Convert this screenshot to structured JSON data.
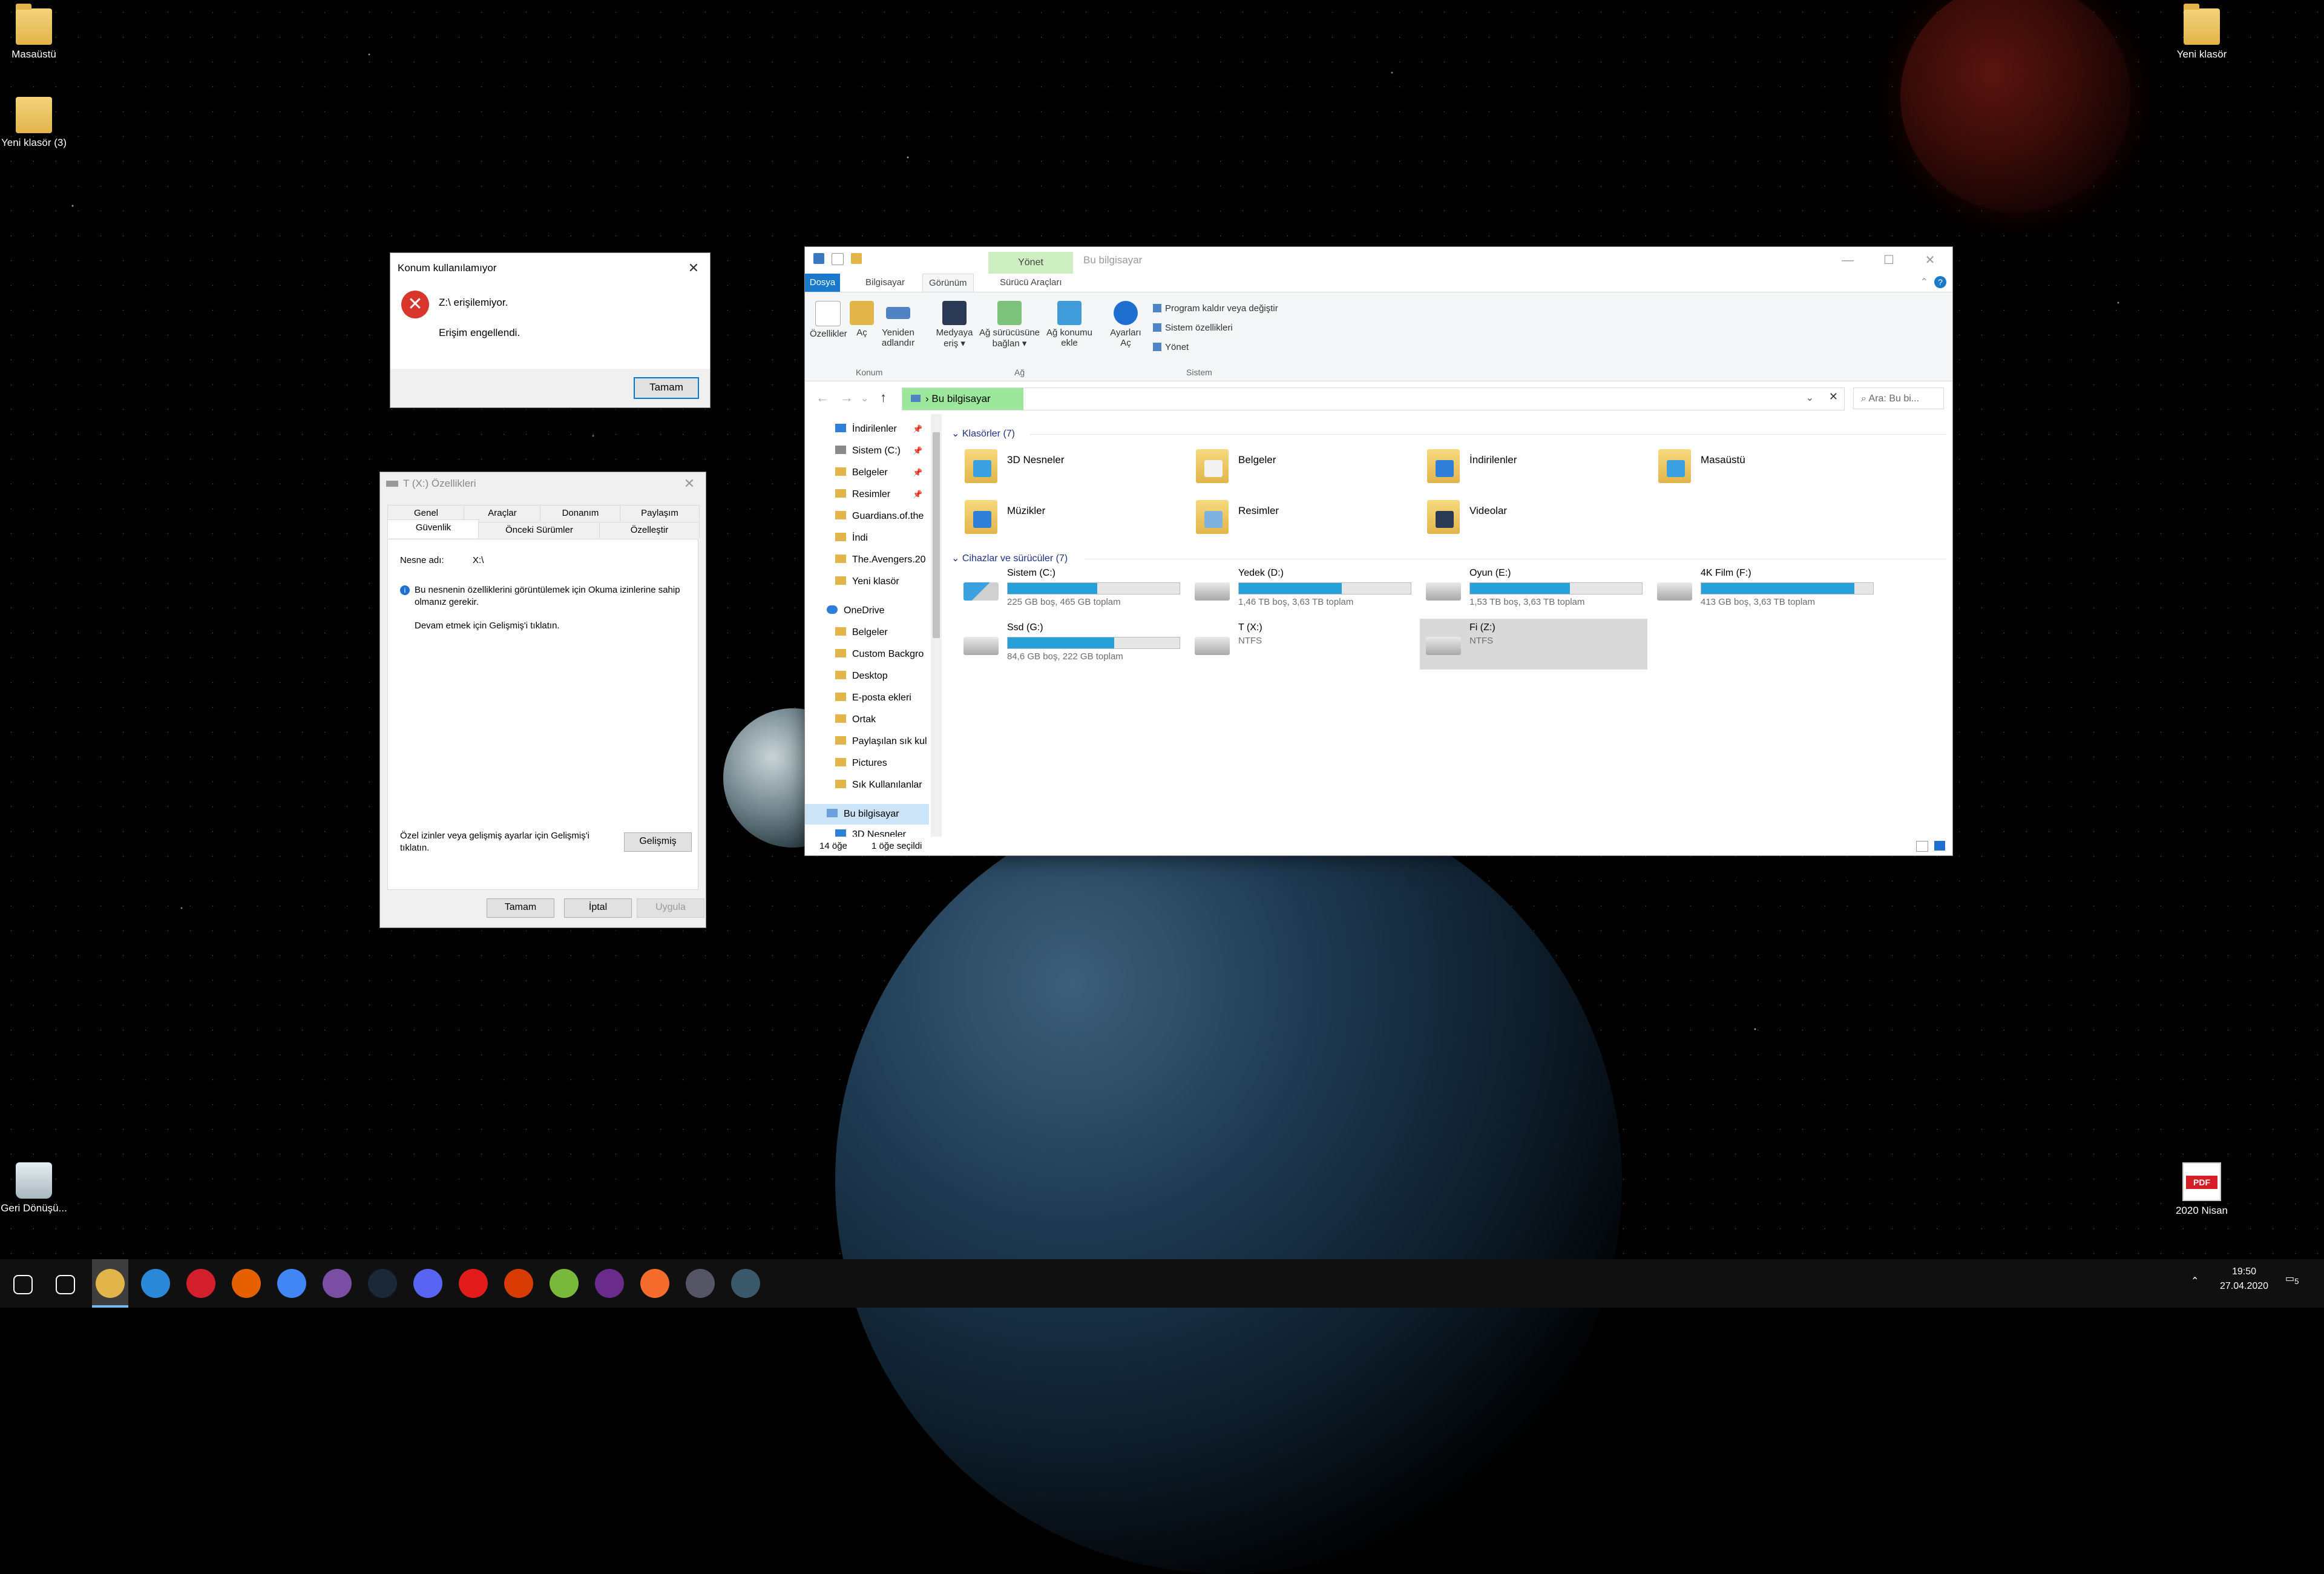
{
  "desktop": {
    "icons_left": [
      {
        "label": "Masaüstü",
        "icon": "folder-zip-icon"
      },
      {
        "label": "Yeni klasör (3)",
        "icon": "folder-doc-icon"
      },
      {
        "label": "Geri Dönüşü...",
        "icon": "recycle-bin-icon"
      }
    ],
    "icons_right": [
      {
        "label": "Yeni klasör",
        "icon": "folder-icon"
      },
      {
        "label": "2020 Nisan",
        "icon": "pdf-file-icon",
        "badge": "PDF"
      }
    ]
  },
  "error_dialog": {
    "title": "Konum kullanılamıyor",
    "message": "Z:\\ erişilemiyor.",
    "detail": "Erişim engellendi.",
    "ok_label": "Tamam"
  },
  "properties_dialog": {
    "title": "T (X:) Özellikleri",
    "tabs_row1": [
      "Genel",
      "Araçlar",
      "Donanım",
      "Paylaşım"
    ],
    "tabs_row2": [
      "Güvenlik",
      "Önceki Sürümler",
      "Özelleştir"
    ],
    "object_label": "Nesne adı:",
    "object_value": "X:\\",
    "info_text": "Bu nesnenin özelliklerini görüntülemek için Okuma izinlerine sahip olmanız gerekir.",
    "continue_text": "Devam etmek için Gelişmiş'i tıklatın.",
    "advanced_text": "Özel izinler veya gelişmiş ayarlar için Gelişmiş'i tıklatın.",
    "advanced_button": "Gelişmiş",
    "ok_button": "Tamam",
    "cancel_button": "İptal",
    "apply_button": "Uygula"
  },
  "explorer": {
    "title": "Bu bilgisayar",
    "contextual_tab": "Yönet",
    "ribbon_tabs": [
      "Dosya",
      "Bilgisayar",
      "Görünüm",
      "Sürücü Araçları"
    ],
    "ribbon_buttons": [
      {
        "label": "Özellikler",
        "icon": "properties-icon"
      },
      {
        "label": "Aç",
        "icon": "open-folder-icon"
      },
      {
        "label": "Yeniden adlandır",
        "icon": "rename-icon"
      },
      {
        "label": "Medyaya eriş ▾",
        "icon": "media-access-icon"
      },
      {
        "label": "Ağ sürücüsüne bağlan ▾",
        "icon": "map-network-drive-icon"
      },
      {
        "label": "Ağ konumu ekle",
        "icon": "add-network-location-icon"
      },
      {
        "label": "Ayarları Aç",
        "icon": "settings-icon"
      }
    ],
    "ribbon_small": [
      "Program kaldır veya değiştir",
      "Sistem özellikleri",
      "Yönet"
    ],
    "ribbon_groups": [
      "Konum",
      "Ağ",
      "Sistem"
    ],
    "address": "Bu bilgisayar",
    "search_placeholder": "Ara: Bu bi...",
    "nav_items": [
      {
        "label": "İndirilenler",
        "pinned": true,
        "icon": "blue"
      },
      {
        "label": "Sistem (C:)",
        "pinned": true,
        "icon": "drive"
      },
      {
        "label": "Belgeler",
        "pinned": true,
        "icon": "folder"
      },
      {
        "label": "Resimler",
        "pinned": true,
        "icon": "folder"
      },
      {
        "label": "Guardians.of.the",
        "pinned": false,
        "icon": "folder"
      },
      {
        "label": "İndi",
        "pinned": false,
        "icon": "folder"
      },
      {
        "label": "The.Avengers.20",
        "pinned": false,
        "icon": "folder"
      },
      {
        "label": "Yeni klasör",
        "pinned": false,
        "icon": "folder"
      },
      {
        "label": "OneDrive",
        "pinned": false,
        "icon": "cloud"
      },
      {
        "label": "Belgeler",
        "pinned": false,
        "icon": "folder"
      },
      {
        "label": "Custom Backgro",
        "pinned": false,
        "icon": "folder"
      },
      {
        "label": "Desktop",
        "pinned": false,
        "icon": "folder"
      },
      {
        "label": "E-posta ekleri",
        "pinned": false,
        "icon": "folder"
      },
      {
        "label": "Ortak",
        "pinned": false,
        "icon": "folder"
      },
      {
        "label": "Paylaşılan sık kul",
        "pinned": false,
        "icon": "folder"
      },
      {
        "label": "Pictures",
        "pinned": false,
        "icon": "folder"
      },
      {
        "label": "Sık Kullanılanlar",
        "pinned": false,
        "icon": "folder"
      },
      {
        "label": "Bu bilgisayar",
        "pinned": false,
        "icon": "pc"
      },
      {
        "label": "3D Nesneler",
        "pinned": false,
        "icon": "blue"
      }
    ],
    "folders_header": "Klasörler (7)",
    "folders": [
      "3D Nesneler",
      "Belgeler",
      "İndirilenler",
      "Masaüstü",
      "Müzikler",
      "Resimler",
      "Videolar"
    ],
    "drives_header": "Cihazlar ve sürücüler (7)",
    "drives": [
      {
        "name": "Sistem (C:)",
        "sub": "225 GB boş, 465 GB toplam",
        "used_fraction": 0.52
      },
      {
        "name": "Yedek  (D:)",
        "sub": "1,46 TB boş, 3,63 TB toplam",
        "used_fraction": 0.6
      },
      {
        "name": "Oyun (E:)",
        "sub": "1,53 TB boş, 3,63 TB toplam",
        "used_fraction": 0.58
      },
      {
        "name": "4K Film (F:)",
        "sub": "413 GB boş, 3,63 TB toplam",
        "used_fraction": 0.89
      },
      {
        "name": "Ssd (G:)",
        "sub": "84,6 GB boş, 222 GB toplam",
        "used_fraction": 0.62
      },
      {
        "name": "T (X:)",
        "sub": "NTFS",
        "used_fraction": null
      },
      {
        "name": "Fi (Z:)",
        "sub": "NTFS",
        "used_fraction": null
      }
    ],
    "status_count": "14 öğe",
    "status_selected": "1 öğe seçildi"
  },
  "taskbar": {
    "apps": [
      "start-icon",
      "task-view-icon",
      "file-explorer-icon",
      "mail-icon",
      "opera-icon",
      "firefox-icon",
      "chrome-icon",
      "tor-browser-icon",
      "steam-icon",
      "discord-icon",
      "youtube-music-icon",
      "office-icon",
      "utorrent-icon",
      "nzxt-icon",
      "origin-icon",
      "gaming-app-icon",
      "chrome-remote-icon"
    ],
    "time": "19:50",
    "date": "27.04.2020",
    "notification_count": "5",
    "colors": {
      "taskbar_bg": "#101010",
      "accent": "#0078d7",
      "drive_bar": "#26a0da",
      "address_highlight": "#9be89c"
    }
  }
}
